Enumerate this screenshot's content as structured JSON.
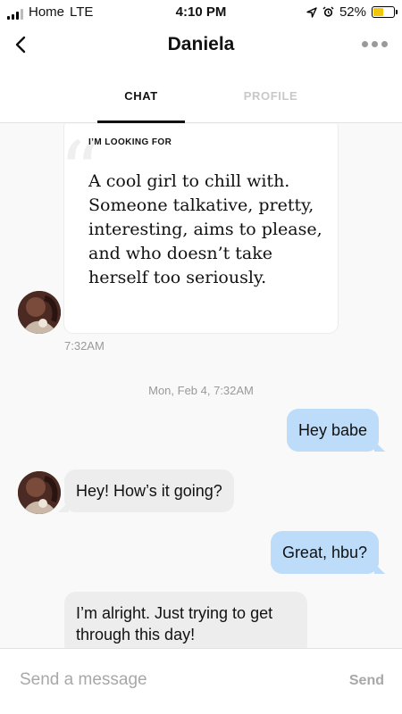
{
  "status_bar": {
    "carrier": "Home",
    "network": "LTE",
    "time": "4:10 PM",
    "battery_percent": "52%",
    "battery_level": 0.52
  },
  "header": {
    "title": "Daniela",
    "tabs": [
      {
        "label": "CHAT",
        "active": true
      },
      {
        "label": "PROFILE",
        "active": false
      }
    ]
  },
  "prompt_card": {
    "label": "I’M LOOKING FOR",
    "answer": "A cool girl to chill with. Someone talkative, pretty, interesting, aims to please, and who doesn’t take herself too seriously.",
    "time": "7:32AM"
  },
  "date_separator": "Mon, Feb 4, 7:32AM",
  "messages": [
    {
      "direction": "outgoing",
      "text": "Hey babe"
    },
    {
      "direction": "incoming",
      "text": "Hey! How’s it going?"
    },
    {
      "direction": "outgoing",
      "text": "Great, hbu?"
    },
    {
      "direction": "incoming",
      "text": "I’m alright. Just trying to get through this day!"
    }
  ],
  "composer": {
    "placeholder": "Send a message",
    "value": "",
    "send_label": "Send"
  },
  "colors": {
    "outgoing_bubble": "#bcdcf9",
    "incoming_bubble": "#ededed",
    "battery": "#f4c60b"
  }
}
